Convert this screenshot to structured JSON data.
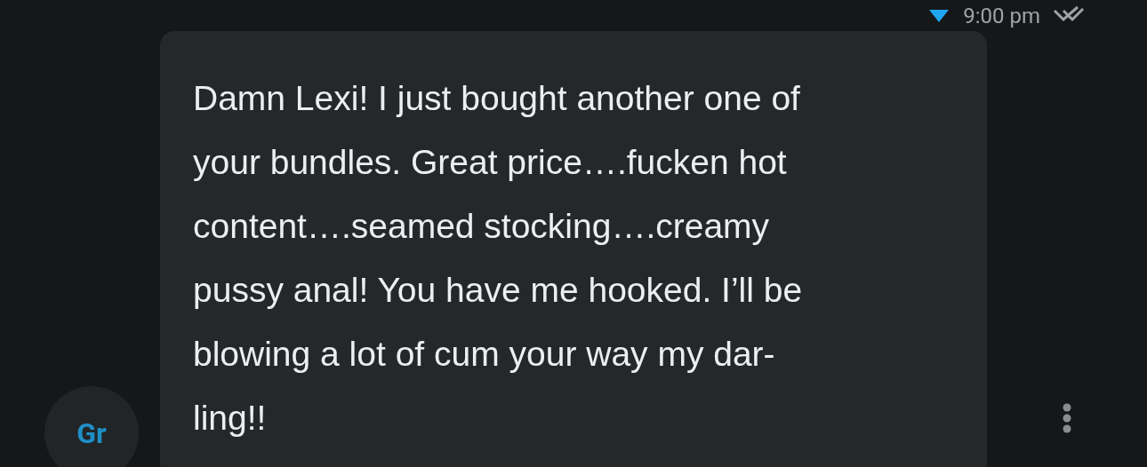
{
  "message": {
    "time": "9:00 pm",
    "read": true,
    "text": "Damn Lexi! I just bought another one of\nyour bundles. Great price….fucken hot\ncontent….seamed stocking….creamy\npussy anal! You have me hooked. I’ll be\nblowing a lot of cum your way my dar-\nling!!",
    "avatar_initials": "Gr"
  }
}
